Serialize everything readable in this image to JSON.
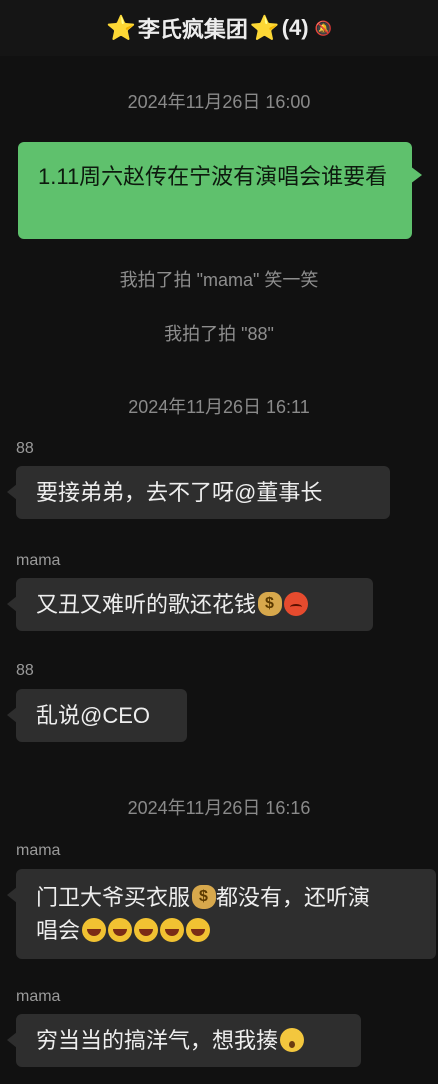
{
  "header": {
    "title": "李氏疯集团",
    "count": "(4)",
    "star_icon": "⭐",
    "mute_icon": "🔕"
  },
  "timestamps": [
    "2024年11月26日 16:00",
    "2024年11月26日 16:11",
    "2024年11月26日 16:16"
  ],
  "outgoing_message": "1.11周六赵传在宁波有演唱会谁要看",
  "system_messages": [
    "我拍了拍 \"mama\" 笑一笑",
    "我拍了拍 \"88\""
  ],
  "messages": [
    {
      "sender": "88",
      "text": "要接弟弟，去不了呀@董事长"
    },
    {
      "sender": "mama",
      "text": "又丑又难听的歌还花钱"
    },
    {
      "sender": "88",
      "text": "乱说@CEO"
    },
    {
      "sender": "mama",
      "text_line1": "门卫大爷买衣服",
      "text_line1b": "都没有，还听演",
      "text_line2": "唱会"
    },
    {
      "sender": "mama",
      "text": "穷当当的搞洋气，想我揍"
    }
  ],
  "emoji_names": [
    "money-bag",
    "angry-face",
    "laughing-face",
    "flushed-face"
  ]
}
